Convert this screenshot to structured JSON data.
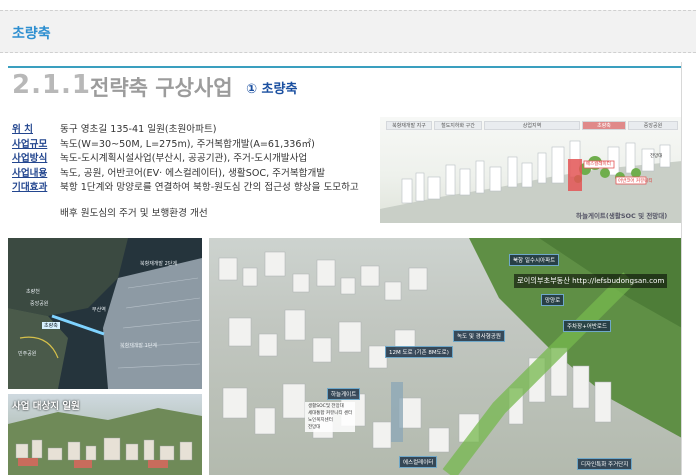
{
  "header": {
    "title": "초량축"
  },
  "section": {
    "number": "2.1.1",
    "title": "전략축 구상사업",
    "subtitle": "① 초량축"
  },
  "info": {
    "rows": [
      {
        "label": "위    치",
        "value": "동구 영초길 135-41 일원(초원아파트)"
      },
      {
        "label": "사업규모",
        "value": "녹도(W=30~50M, L=275m), 주거복합개발(A=61,336㎡)"
      },
      {
        "label": "사업방식",
        "value": "녹도-도시계획시설사업(부산시, 공공기관), 주거-도시개발사업"
      },
      {
        "label": "사업내용",
        "value": "녹도, 공원, 어반코어(EV· 에스컬레이터), 생활SOC, 주거복합개발"
      },
      {
        "label": "기대효과",
        "value": "북항 1단계와 망양로를 연결하여 북항-원도심 간의 접근성 향상을 도모하고"
      }
    ],
    "continuation": "배후 원도심의 주거 및 보행환경 개선"
  },
  "top_render": {
    "bar": [
      "북항재개발 지구",
      "철도지하화 구간",
      "상업지역",
      "초량축",
      "중앙공원"
    ],
    "labels": [
      "하늘게이트(생활SOC 및 전망대)",
      "에스컬레이터",
      "전망대",
      "어반코어 커뮤니티"
    ]
  },
  "aerial_map": {
    "labels": [
      "북항재개발 2단계",
      "부산역",
      "초량천",
      "중앙공원",
      "초량축",
      "북항재개발 1단계",
      "민주공원"
    ]
  },
  "street_photo": {
    "title": "사업 대상지 일원"
  },
  "main_render": {
    "watermark": "로이의부초부동산 http://lefsbudongsan.com",
    "callouts": [
      "망양로",
      "북항 일수시아파트",
      "녹도 및 경사형공원",
      "주차장+어반로드",
      "12M 도로 (기존 8M도로)",
      "하늘게이트",
      "에스컬레이터",
      "디자인특화 주거단지"
    ],
    "gate_items": [
      "생활SOC및 전망대",
      "세대통합 커뮤니티 센터",
      "노인복지센터",
      "전망대"
    ]
  },
  "colors": {
    "accent": "#2e8fd0",
    "section_sub": "#1a4fa0",
    "rule": "#3a9fbf",
    "label": "#23468f"
  }
}
